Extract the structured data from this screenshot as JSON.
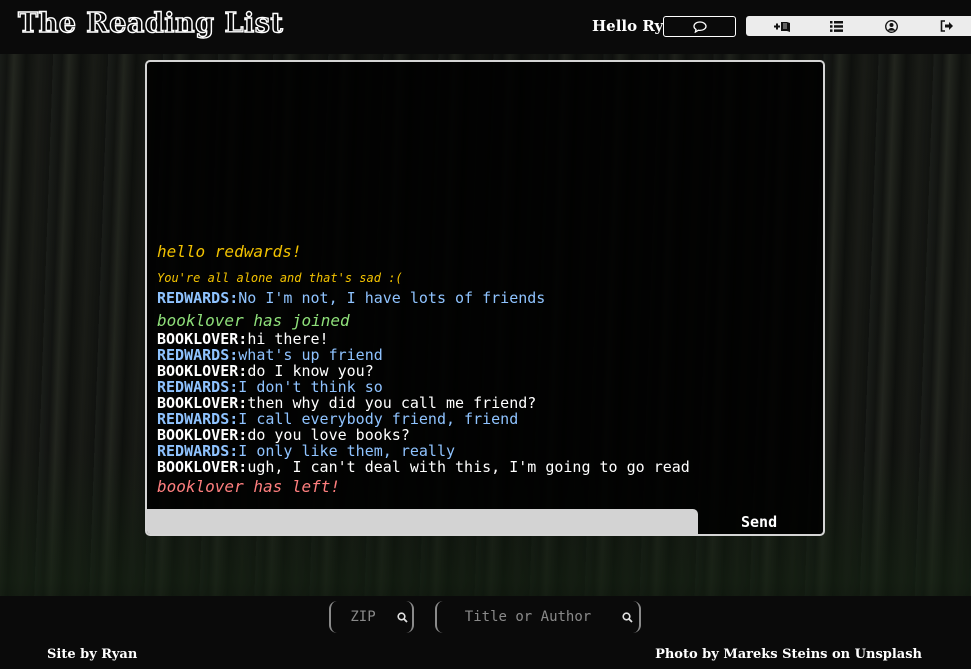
{
  "header": {
    "brand": "The Reading List",
    "greeting": "Hello Ryan!",
    "nav": [
      {
        "icon": "chat-bubble-icon"
      },
      {
        "icon": "add-book-icon"
      },
      {
        "icon": "list-icon"
      },
      {
        "icon": "user-icon"
      },
      {
        "icon": "sign-out-icon"
      }
    ]
  },
  "chat": {
    "hello": "hello redwards!",
    "alone": "You're all alone and that's sad :(",
    "messages_before_join": [
      {
        "user": "REDWARDS:",
        "text": "No I'm not, I have lots of friends"
      }
    ],
    "join_notice": "booklover has joined",
    "messages": [
      {
        "user": "BOOKLOVER:",
        "text": "hi there!"
      },
      {
        "user": "REDWARDS:",
        "text": "what's up friend"
      },
      {
        "user": "BOOKLOVER:",
        "text": "do I know you?"
      },
      {
        "user": "REDWARDS:",
        "text": "I don't think so"
      },
      {
        "user": "BOOKLOVER:",
        "text": "then why did you call me friend?"
      },
      {
        "user": "REDWARDS:",
        "text": "I call everybody friend, friend"
      },
      {
        "user": "BOOKLOVER:",
        "text": "do you love books?"
      },
      {
        "user": "REDWARDS:",
        "text": "I only like them, really"
      },
      {
        "user": "BOOKLOVER:",
        "text": "ugh, I can't deal with this, I'm going to go read"
      }
    ],
    "left_notice": "booklover has left!",
    "input_value": "",
    "send_label": "Send"
  },
  "footer": {
    "zip_placeholder": "ZIP",
    "title_placeholder": "Title or Author",
    "site_credit": "Site by Ryan",
    "photo_credit": "Photo by Mareks Steins on Unsplash"
  },
  "colors": {
    "system": "#f2c200",
    "join": "#8fe07a",
    "left": "#ff7f7f",
    "redwards": "#8fc3ff",
    "booklover": "#ffffff"
  }
}
